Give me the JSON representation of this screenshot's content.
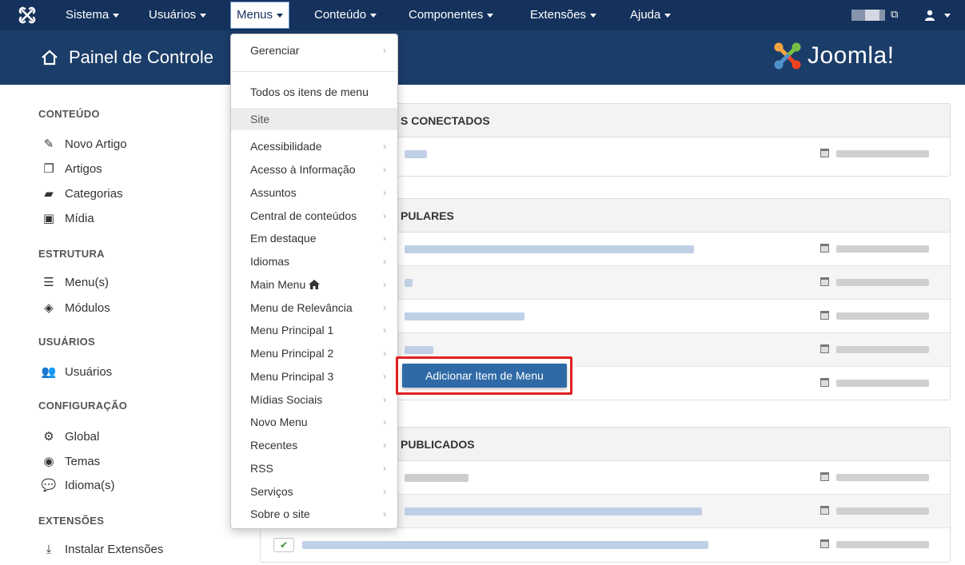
{
  "navbar": {
    "items": [
      {
        "label": "Sistema"
      },
      {
        "label": "Usuários"
      },
      {
        "label": "Menus"
      },
      {
        "label": "Conteúdo"
      },
      {
        "label": "Componentes"
      },
      {
        "label": "Extensões"
      },
      {
        "label": "Ajuda"
      }
    ],
    "active_index": 2,
    "icons": {
      "logo": "joomla-icon",
      "external": "external-link-icon",
      "user": "user-icon"
    }
  },
  "header": {
    "title": "Painel de Controle",
    "brand": "Joomla!"
  },
  "sidebar": {
    "sections": [
      {
        "heading": "CONTEÚDO",
        "items": [
          "Novo Artigo",
          "Artigos",
          "Categorias",
          "Mídia"
        ]
      },
      {
        "heading": "ESTRUTURA",
        "items": [
          "Menu(s)",
          "Módulos"
        ]
      },
      {
        "heading": "USUÁRIOS",
        "items": [
          "Usuários"
        ]
      },
      {
        "heading": "CONFIGURAÇÃO",
        "items": [
          "Global",
          "Temas",
          "Idioma(s)"
        ]
      },
      {
        "heading": "EXTENSÕES",
        "items": [
          "Instalar Extensões"
        ]
      }
    ]
  },
  "panels": [
    {
      "title": "S CONECTADOS"
    },
    {
      "title": "PULARES"
    },
    {
      "title": "PUBLICADOS"
    }
  ],
  "dropdown": {
    "manage": "Gerenciar",
    "all_items": "Todos os itens de menu",
    "site": "Site",
    "menus": [
      "Acessibilidade",
      "Acesso à Informação",
      "Assuntos",
      "Central de conteúdos",
      "Em destaque",
      "Idiomas",
      "Main Menu",
      "Menu de Relevância",
      "Menu Principal 1",
      "Menu Principal 2",
      "Menu Principal 3",
      "Mídias Sociais",
      "Novo Menu",
      "Recentes",
      "RSS",
      "Serviços",
      "Sobre o site"
    ],
    "home_marker_icon": "home-icon",
    "arrow": "›"
  },
  "submenu": {
    "add_item": "Adicionar Item de Menu"
  },
  "colors": {
    "navbar": "#15325c",
    "header": "#1b3d69",
    "submenu_button": "#2f6aa6",
    "highlight": "#e02020"
  }
}
